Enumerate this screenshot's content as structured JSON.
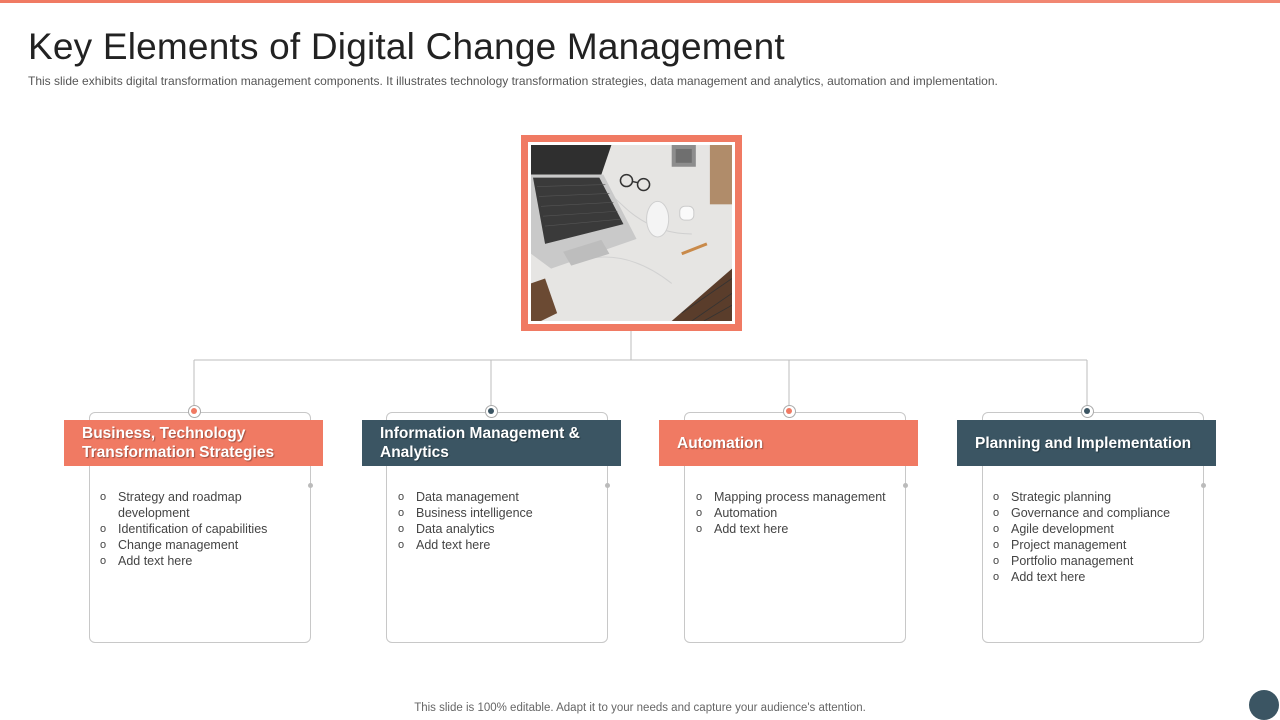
{
  "title": "Key Elements of Digital Change Management",
  "subtitle": "This slide exhibits digital transformation management components. It illustrates technology transformation  strategies, data management  and analytics, automation and implementation.",
  "footer": "This slide is 100% editable. Adapt it to your needs and capture your audience's attention.",
  "colors": {
    "accent": "#f07a63",
    "dark": "#3b5563"
  },
  "image": {
    "subject": "laptop-desk-icon"
  },
  "columns": [
    {
      "header": "Business,  Technology Transformation Strategies",
      "items": [
        "Strategy and roadmap development",
        "Identification  of capabilities",
        "Change  management",
        "Add text here"
      ]
    },
    {
      "header": "Information Management & Analytics",
      "items": [
        "Data management",
        "Business intelligence",
        "Data analytics",
        "Add text here"
      ]
    },
    {
      "header": "Automation",
      "items": [
        "Mapping process management",
        "Automation",
        "Add text here"
      ]
    },
    {
      "header": "Planning and Implementation",
      "items": [
        "Strategic planning",
        "Governance  and compliance",
        "Agile development",
        "Project management",
        "Portfolio management",
        "Add text here"
      ]
    }
  ]
}
